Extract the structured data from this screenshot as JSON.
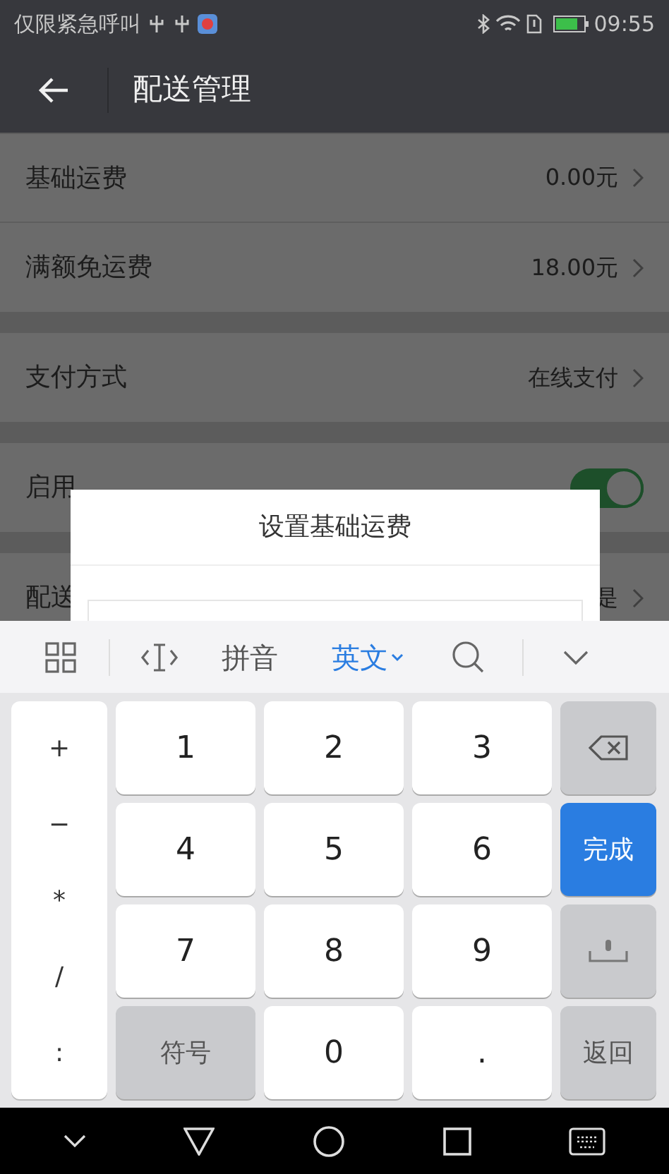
{
  "status_bar": {
    "carrier": "仅限紧急呼叫",
    "time": "09:55"
  },
  "header": {
    "title": "配送管理"
  },
  "groups": [
    [
      {
        "kind": "link",
        "label": "基础运费",
        "value": "0.00元"
      },
      {
        "kind": "link",
        "label": "满额免运费",
        "value": "18.00元"
      }
    ],
    [
      {
        "kind": "link",
        "label": "支付方式",
        "value": "在线支付"
      }
    ],
    [
      {
        "kind": "toggle",
        "label": "启用",
        "on": true
      }
    ],
    [
      {
        "kind": "link",
        "label": "配送",
        "value": "是"
      }
    ]
  ],
  "dialog": {
    "title": "设置基础运费"
  },
  "keyboard": {
    "modes": [
      {
        "label": "拼音",
        "selected": false
      },
      {
        "label": "英文",
        "selected": true
      }
    ],
    "symbols": [
      "+",
      "−",
      "*",
      "/",
      ":"
    ],
    "keys": [
      {
        "kind": "key",
        "label": "1"
      },
      {
        "kind": "key",
        "label": "2"
      },
      {
        "kind": "key",
        "label": "3"
      },
      {
        "kind": "backspace"
      },
      {
        "kind": "key",
        "label": "4"
      },
      {
        "kind": "key",
        "label": "5"
      },
      {
        "kind": "key",
        "label": "6"
      },
      {
        "kind": "done",
        "label": "完成"
      },
      {
        "kind": "key",
        "label": "7"
      },
      {
        "kind": "key",
        "label": "8"
      },
      {
        "kind": "key",
        "label": "9"
      },
      {
        "kind": "space"
      },
      {
        "kind": "function",
        "label": "符号"
      },
      {
        "kind": "key",
        "label": "0"
      },
      {
        "kind": "key",
        "label": "."
      },
      {
        "kind": "function",
        "label": "返回"
      }
    ]
  }
}
